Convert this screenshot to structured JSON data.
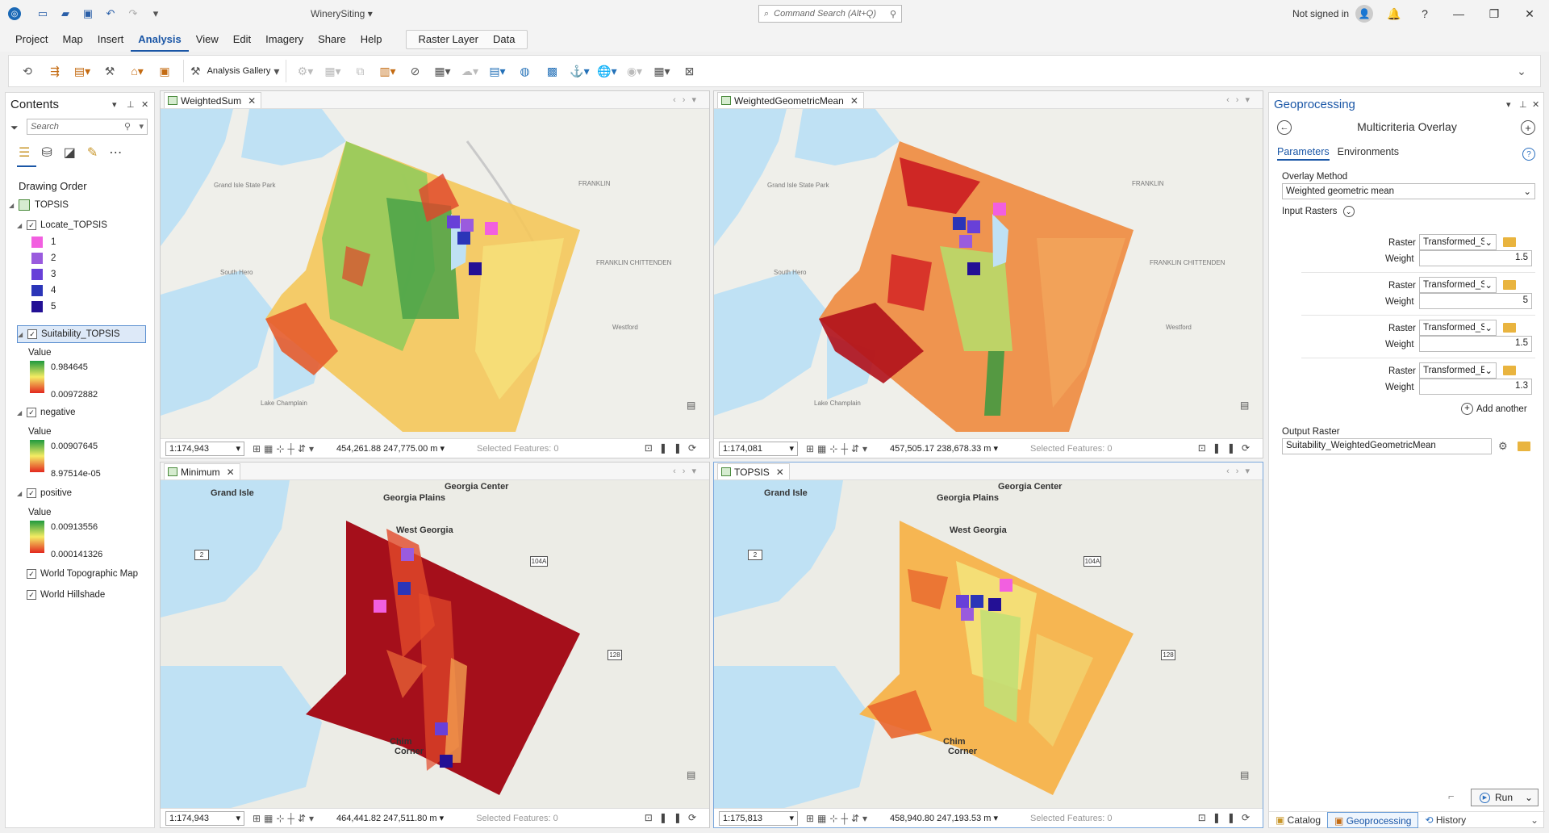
{
  "title_bar": {
    "project_name": "WinerySiting",
    "command_search_placeholder": "Command Search (Alt+Q)",
    "signin_text": "Not signed in"
  },
  "menu": {
    "tabs": [
      "Project",
      "Map",
      "Insert",
      "Analysis",
      "View",
      "Edit",
      "Imagery",
      "Share",
      "Help"
    ],
    "active": "Analysis",
    "contextual_tabs": [
      "Raster Layer",
      "Data"
    ]
  },
  "ribbon": {
    "analysis_gallery_label": "Analysis Gallery"
  },
  "contents": {
    "title": "Contents",
    "search_placeholder": "Search",
    "drawing_order_label": "Drawing Order",
    "map_name": "TOPSIS",
    "layers": {
      "locate": {
        "name": "Locate_TOPSIS",
        "classes": [
          {
            "label": "1",
            "color": "#f25fe0"
          },
          {
            "label": "2",
            "color": "#9a5bde"
          },
          {
            "label": "3",
            "color": "#6840d8"
          },
          {
            "label": "4",
            "color": "#2b35b8"
          },
          {
            "label": "5",
            "color": "#231095"
          }
        ]
      },
      "suitability": {
        "name": "Suitability_TOPSIS",
        "value_label": "Value",
        "high": "0.984645",
        "low": "0.00972882"
      },
      "negative": {
        "name": "negative",
        "value_label": "Value",
        "high": "0.00907645",
        "low": "8.97514e-05"
      },
      "positive": {
        "name": "positive",
        "value_label": "Value",
        "high": "0.00913556",
        "low": "0.000141326"
      },
      "basemap1": {
        "name": "World Topographic Map"
      },
      "basemap2": {
        "name": "World Hillshade"
      }
    }
  },
  "maps": {
    "weightedsum": {
      "tab": "WeightedSum",
      "scale": "1:174,943",
      "coords": "454,261.88 247,775.00 m",
      "selected": "Selected Features: 0"
    },
    "geomean": {
      "tab": "WeightedGeometricMean",
      "scale": "1:174,081",
      "coords": "457,505.17 238,678.33 m",
      "selected": "Selected Features: 0"
    },
    "minimum": {
      "tab": "Minimum",
      "scale": "1:174,943",
      "coords": "464,441.82 247,511.80 m",
      "selected": "Selected Features: 0"
    },
    "topsis": {
      "tab": "TOPSIS",
      "scale": "1:175,813",
      "coords": "458,940.80 247,193.53 m",
      "selected": "Selected Features: 0"
    }
  },
  "map_labels": {
    "grand_isle": "Grand Isle",
    "georgia_center": "Georgia Center",
    "georgia_plains": "Georgia Plains",
    "west_georgia": "West Georgia",
    "chimney_corner_1": "Chim",
    "chimney_corner_2": "Corner",
    "route_2": "2",
    "route_104a": "104A",
    "route_128": "128",
    "franklin": "FRANKLIN",
    "chittenden": "FRANKLIN CHITTENDEN",
    "geo_park": "Grand Isle State Park",
    "south_hero": "South Hero",
    "westford": "Westford",
    "lake": "Lake Champlain"
  },
  "geoprocessing": {
    "title": "Geoprocessing",
    "tool_name": "Multicriteria Overlay",
    "tabs": [
      "Parameters",
      "Environments"
    ],
    "overlay_method_label": "Overlay Method",
    "overlay_method_value": "Weighted geometric mean",
    "input_rasters_label": "Input Rasters",
    "raster_label": "Raster",
    "weight_label": "Weight",
    "rasters": [
      {
        "raster": "Transformed_Solar",
        "weight": "1.5"
      },
      {
        "raster": "Transformed_Soils",
        "weight": "5"
      },
      {
        "raster": "Transformed_Slope",
        "weight": "1.5"
      },
      {
        "raster": "Transformed_Elevation",
        "weight": "1.3"
      }
    ],
    "add_another": "Add another",
    "output_raster_label": "Output Raster",
    "output_raster_value": "Suitability_WeightedGeometricMean",
    "run_label": "Run",
    "bottom_tabs": [
      "Catalog",
      "Geoprocessing",
      "History"
    ]
  }
}
